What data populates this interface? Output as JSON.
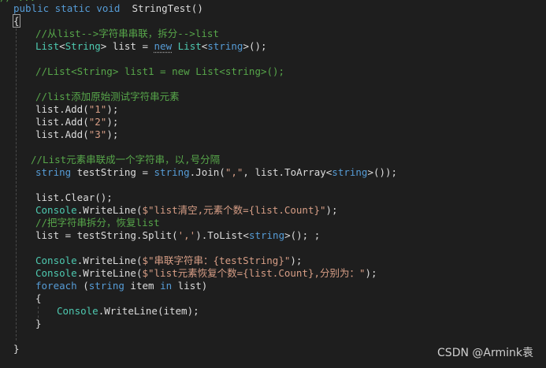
{
  "code": {
    "clipped_top": "// ...",
    "signature": {
      "mods": "public static void",
      "name": "StringTest()"
    },
    "open_brace": "{",
    "c1": "//从list-->字符串串联，拆分-->list",
    "l_list": {
      "t1": "List",
      "t2": "<",
      "t3": "String",
      "t4": "> list = ",
      "t5": "new",
      "t6": " ",
      "t7": "List",
      "t8": "<",
      "t9": "string",
      "t10": ">();"
    },
    "c2": "//List<String> list1 = new List<string>();",
    "c3": "//list添加原始测试字符串元素",
    "add1": {
      "pre": "list.Add(",
      "arg": "\"1\"",
      "post": ");"
    },
    "add2": {
      "pre": "list.Add(",
      "arg": "\"2\"",
      "post": ");"
    },
    "add3": {
      "pre": "list.Add(",
      "arg": "\"3\"",
      "post": ");"
    },
    "c4": "//List元素串联成一个字符串，以,号分隔",
    "join": {
      "kw1": "string",
      "t1": " testString = ",
      "kw2": "string",
      "t2": ".Join(",
      "arg": "\",\"",
      "t3": ", list.ToArray<",
      "kw3": "string",
      "t4": ">());"
    },
    "clear": "list.Clear();",
    "wl1": {
      "ty": "Console",
      "t1": ".WriteLine(",
      "s": "$\"list清空,元素个数={list.Count}\"",
      "t2": ");"
    },
    "c5": "//把字符串拆分，恢复list",
    "split": {
      "t1": "list = testString.Split(",
      "s": "','",
      "t2": ").ToList<",
      "kw": "string",
      "t3": ">(); ;"
    },
    "wl2": {
      "ty": "Console",
      "t1": ".WriteLine(",
      "s": "$\"串联字符串：{testString}\"",
      "t2": ");"
    },
    "wl3": {
      "ty": "Console",
      "t1": ".WriteLine(",
      "s": "$\"list元素恢复个数={list.Count},分别为：\"",
      "t2": ");"
    },
    "foreach": {
      "kw1": "foreach",
      "t1": " (",
      "kw2": "string",
      "t2": " item ",
      "kw3": "in",
      "t3": " list)"
    },
    "fo_open": "{",
    "wl4": {
      "ty": "Console",
      "t1": ".WriteLine(item);"
    },
    "fo_close": "}",
    "close_brace": "}"
  },
  "watermark": "CSDN @Armink袁"
}
